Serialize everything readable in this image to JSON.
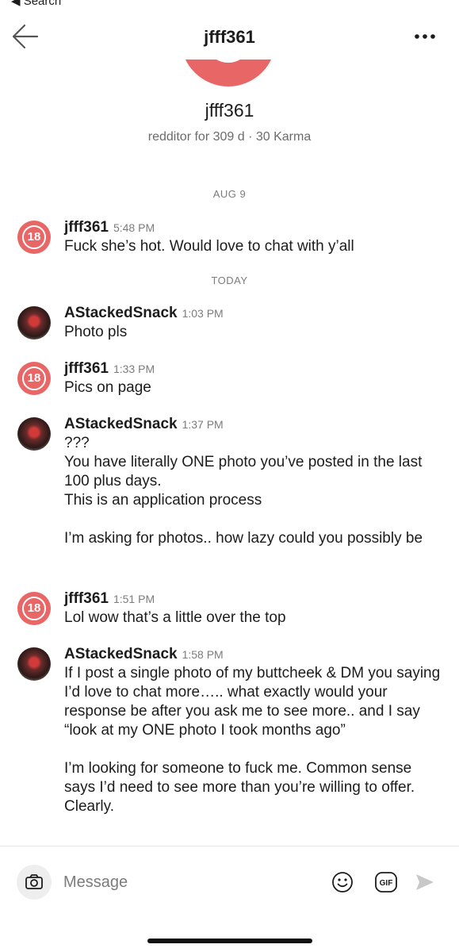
{
  "status": {
    "back_label": "◀ Search"
  },
  "header": {
    "title": "jfff361"
  },
  "profile": {
    "name": "jfff361",
    "meta": "redditor for 309 d · 30 Karma"
  },
  "dates": {
    "first": "AUG 9",
    "second": "TODAY"
  },
  "messages": [
    {
      "author": "jfff361",
      "time": "5:48 PM",
      "text": "Fuck she’s hot. Would love to chat with y’all",
      "avatar": "18"
    },
    {
      "author": "AStackedSnack",
      "time": "1:03 PM",
      "text": "Photo pls",
      "avatar": "photo"
    },
    {
      "author": "jfff361",
      "time": "1:33 PM",
      "text": "Pics on page",
      "avatar": "18"
    },
    {
      "author": "AStackedSnack",
      "time": "1:37 PM",
      "text": "???\nYou have literally ONE photo you’ve posted in the last 100 plus days.\nThis is an application process\n\nI’m asking for photos.. how lazy could you possibly be",
      "avatar": "photo"
    },
    {
      "author": "jfff361",
      "time": "1:51 PM",
      "text": "Lol wow that’s a little over the top",
      "avatar": "18"
    },
    {
      "author": "AStackedSnack",
      "time": "1:58 PM",
      "text": "If I post a single photo of my buttcheek & DM you saying I’d love to chat more….. what exactly would your response be after you ask me to see more.. and I say “look at my ONE photo I took months ago”\n\nI’m looking for someone to fuck me. Common sense says I’d need to see more than you’re willing to offer. Clearly.",
      "avatar": "photo"
    }
  ],
  "avatar_badge": "18",
  "compose": {
    "placeholder": "Message",
    "gif_label": "GIF"
  },
  "icons": {
    "back": "arrow-left-icon",
    "more": "more-dots-icon",
    "camera": "camera-icon",
    "emoji": "emoji-icon",
    "gif": "gif-icon",
    "send": "send-icon"
  },
  "colors": {
    "accent": "#e96666",
    "muted_text": "#7c7c7c",
    "text": "#1c1c1c"
  }
}
